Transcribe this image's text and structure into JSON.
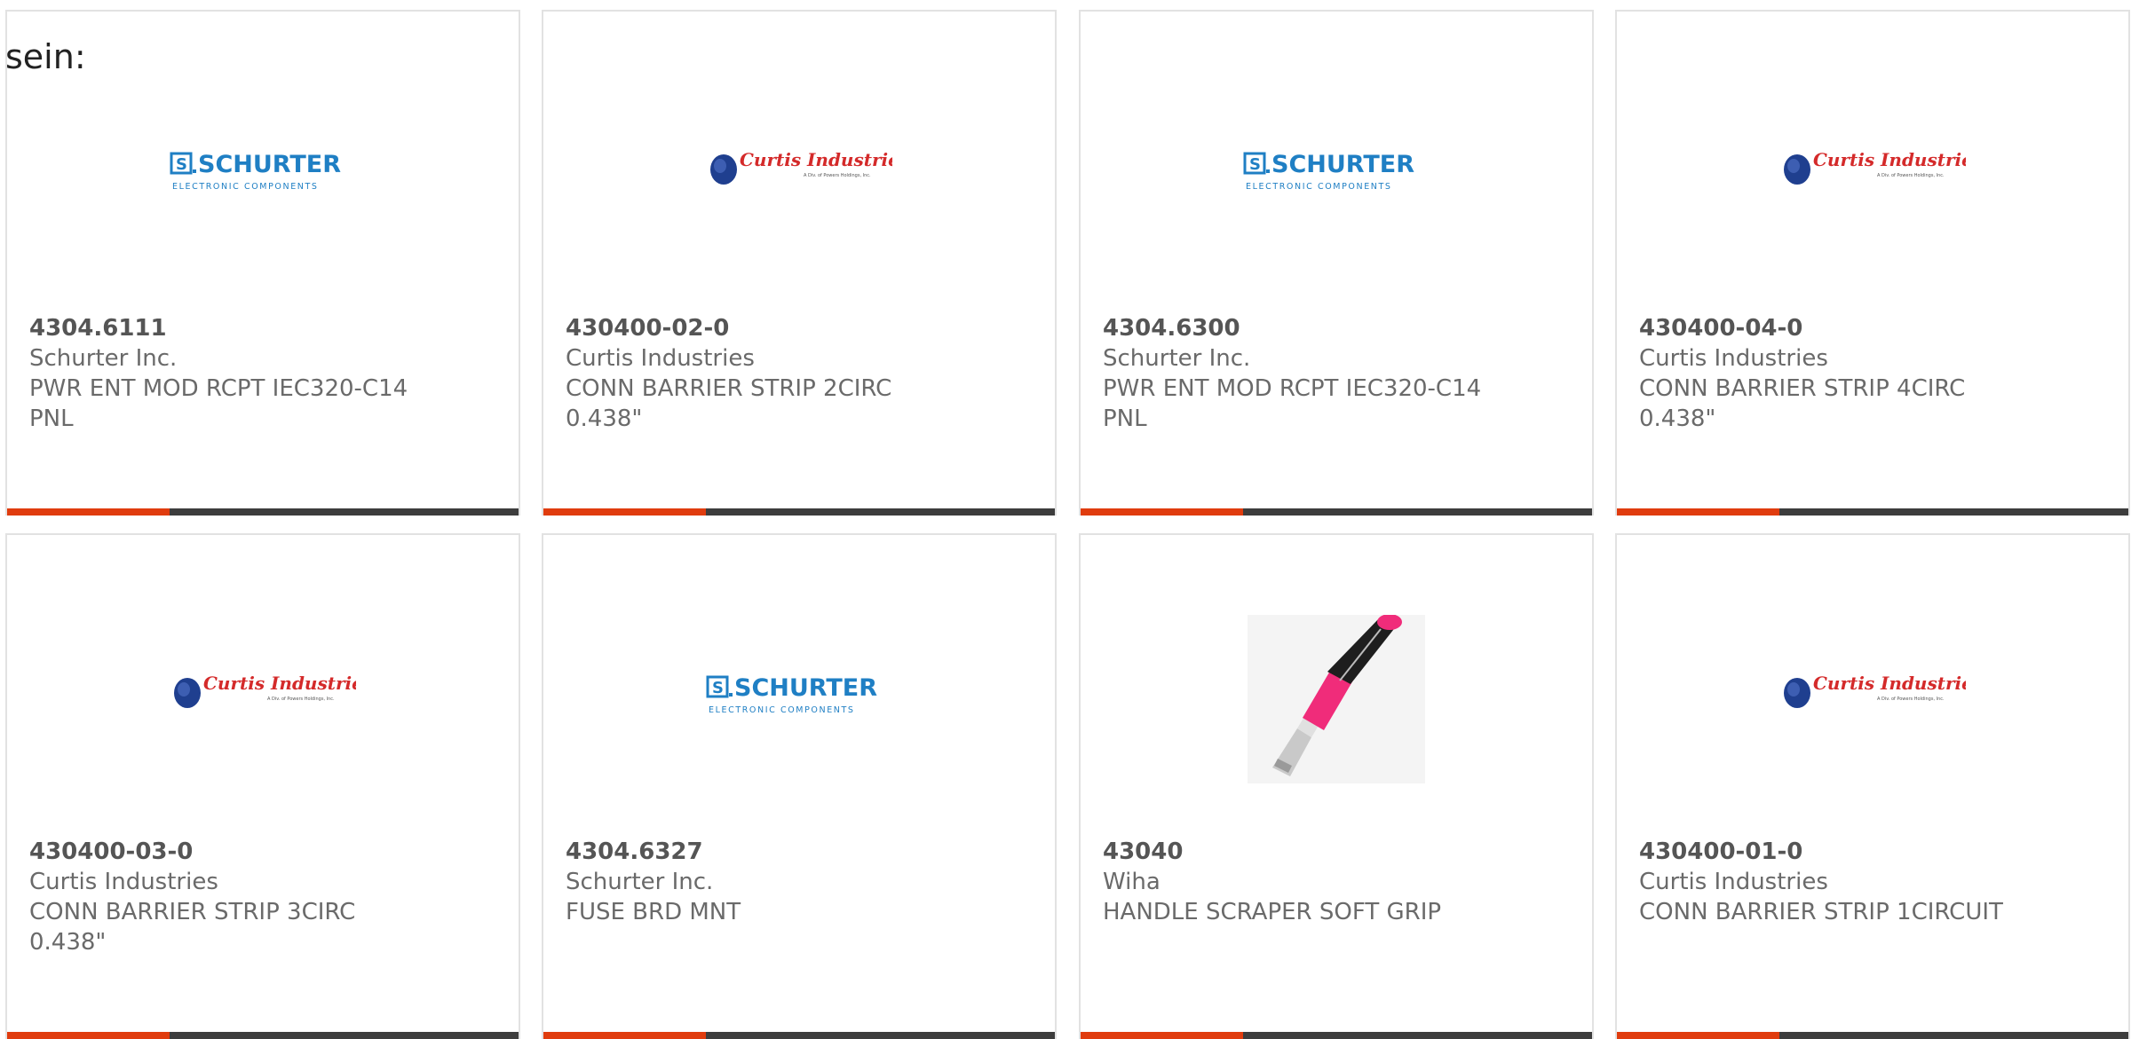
{
  "page": {
    "label": "sein:"
  },
  "products": [
    {
      "part_number": "4304.6111",
      "manufacturer": "Schurter Inc.",
      "description": "PWR ENT MOD RCPT IEC320-C14 PNL",
      "image": "schurter-logo"
    },
    {
      "part_number": "430400-02-0",
      "manufacturer": "Curtis Industries",
      "description": "CONN BARRIER STRIP 2CIRC 0.438\"",
      "image": "curtis-logo"
    },
    {
      "part_number": "4304.6300",
      "manufacturer": "Schurter Inc.",
      "description": "PWR ENT MOD RCPT IEC320-C14 PNL",
      "image": "schurter-logo"
    },
    {
      "part_number": "430400-04-0",
      "manufacturer": "Curtis Industries",
      "description": "CONN BARRIER STRIP 4CIRC 0.438\"",
      "image": "curtis-logo"
    },
    {
      "part_number": "430400-03-0",
      "manufacturer": "Curtis Industries",
      "description": "CONN BARRIER STRIP 3CIRC 0.438\"",
      "image": "curtis-logo"
    },
    {
      "part_number": "4304.6327",
      "manufacturer": "Schurter Inc.",
      "description": "FUSE BRD MNT",
      "image": "schurter-logo"
    },
    {
      "part_number": "43040",
      "manufacturer": "Wiha",
      "description": "HANDLE SCRAPER SOFT GRIP",
      "image": "screwdriver-handle-image"
    },
    {
      "part_number": "430400-01-0",
      "manufacturer": "Curtis Industries",
      "description": "CONN BARRIER STRIP 1CIRCUIT",
      "image": "curtis-logo"
    }
  ],
  "logos": {
    "schurter": {
      "name": "SCHURTER",
      "tagline": "ELECTRONIC COMPONENTS",
      "color": "#1f7fc4"
    },
    "curtis": {
      "name": "Curtis Industries",
      "tagline": "A Div. of Powers Holdings, Inc.",
      "color": "#d42a2a",
      "globe_color": "#1f3f8f"
    }
  },
  "colors": {
    "accent_bar": "#e03c0e",
    "dark_bar": "#3d3d3d",
    "card_border": "#e2e2e2"
  }
}
